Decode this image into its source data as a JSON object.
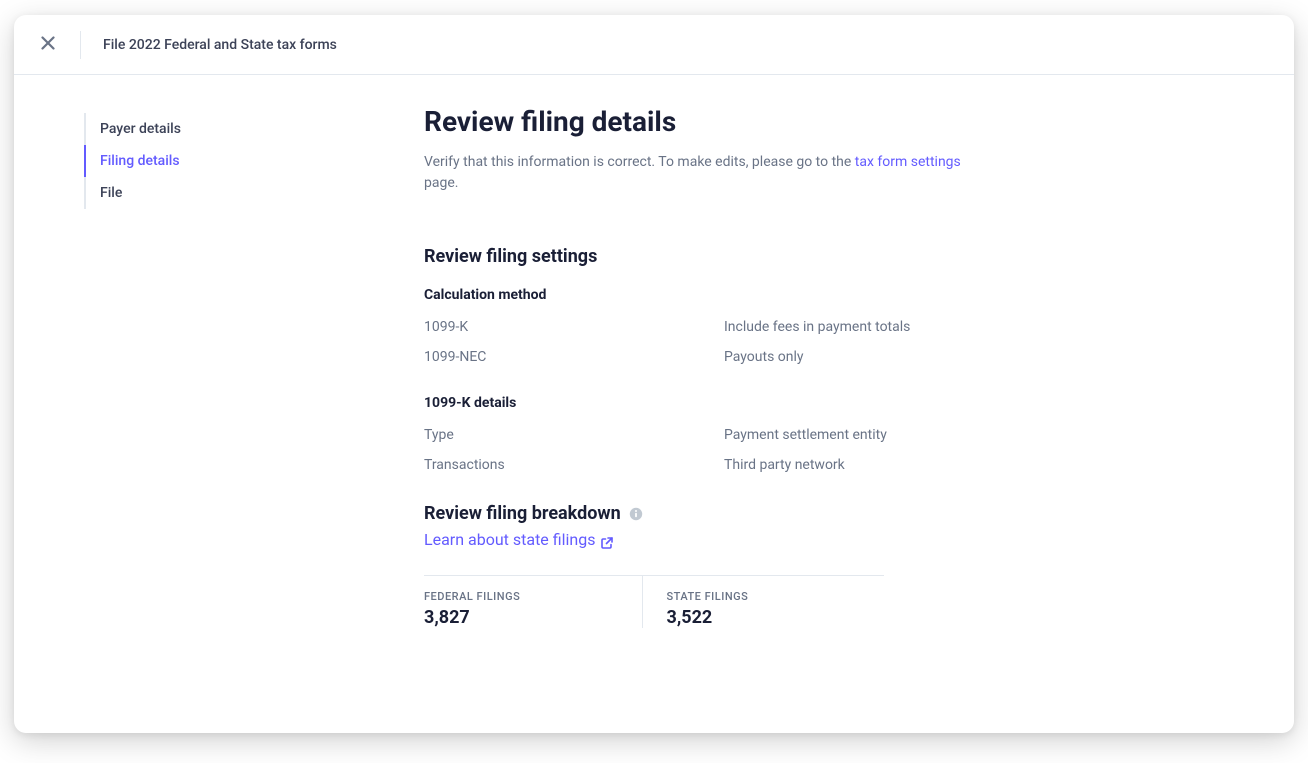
{
  "header": {
    "title": "File 2022 Federal and State tax forms"
  },
  "sidebar": {
    "items": [
      {
        "label": "Payer details",
        "active": false
      },
      {
        "label": "Filing details",
        "active": true
      },
      {
        "label": "File",
        "active": false
      }
    ]
  },
  "main": {
    "title": "Review filing details",
    "subtitle_pre": "Verify that this information is correct. To make edits, please go to the ",
    "subtitle_link": "tax form settings",
    "subtitle_post": " page.",
    "settings_heading": "Review filing settings",
    "calc_heading": "Calculation method",
    "calc_rows": [
      {
        "key": "1099-K",
        "val": "Include fees in payment totals"
      },
      {
        "key": "1099-NEC",
        "val": "Payouts only"
      }
    ],
    "kdetails_heading": "1099-K details",
    "kdetails_rows": [
      {
        "key": "Type",
        "val": "Payment settlement entity"
      },
      {
        "key": "Transactions",
        "val": "Third party network"
      }
    ],
    "breakdown_heading": "Review filing breakdown",
    "learn_link": "Learn about state filings",
    "stats": [
      {
        "label": "FEDERAL FILINGS",
        "value": "3,827"
      },
      {
        "label": "STATE FILINGS",
        "value": "3,522"
      }
    ]
  }
}
